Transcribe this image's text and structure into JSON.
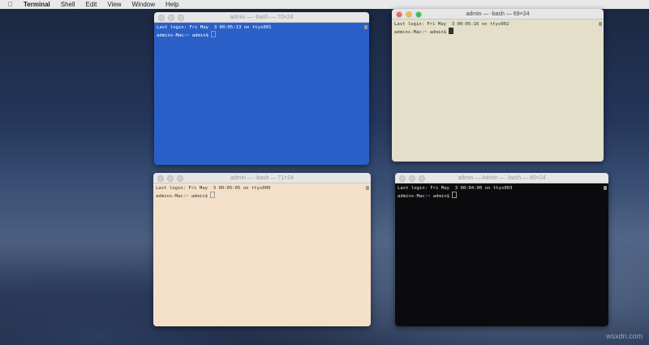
{
  "menubar": {
    "apple": "",
    "app": "Terminal",
    "items": [
      "Shell",
      "Edit",
      "View",
      "Window",
      "Help"
    ]
  },
  "windows": [
    {
      "title": "admin — -bash — 70×24",
      "line1": "Last login: Fri May  3 00:05:13 on ttys001",
      "prompt": "admins-Mac:~ admin$ ",
      "bg": "#2b5fc8",
      "fg": "#ffffff"
    },
    {
      "title": "admin — -bash — 69×24",
      "line1": "Last login: Fri May  3 00:05:16 on ttys002",
      "prompt": "admins-Mac:~ admin$ ",
      "bg": "#e3dfc8",
      "fg": "#333333"
    },
    {
      "title": "admin — -bash — 71×24",
      "line1": "Last login: Fri May  3 00:05:05 on ttys000",
      "prompt": "admins-Mac:~ admin$ ",
      "bg": "#f4e0c9",
      "fg": "#333333"
    },
    {
      "title": "admin — Admin — -bash — 80×24",
      "line1": "Last login: Fri May  3 00:04:00 on ttys003",
      "prompt": "admins-Mac:~ admin$ ",
      "bg": "#0b0b0d",
      "fg": "#e0e0e0"
    }
  ],
  "watermark": "wsxdn.com"
}
